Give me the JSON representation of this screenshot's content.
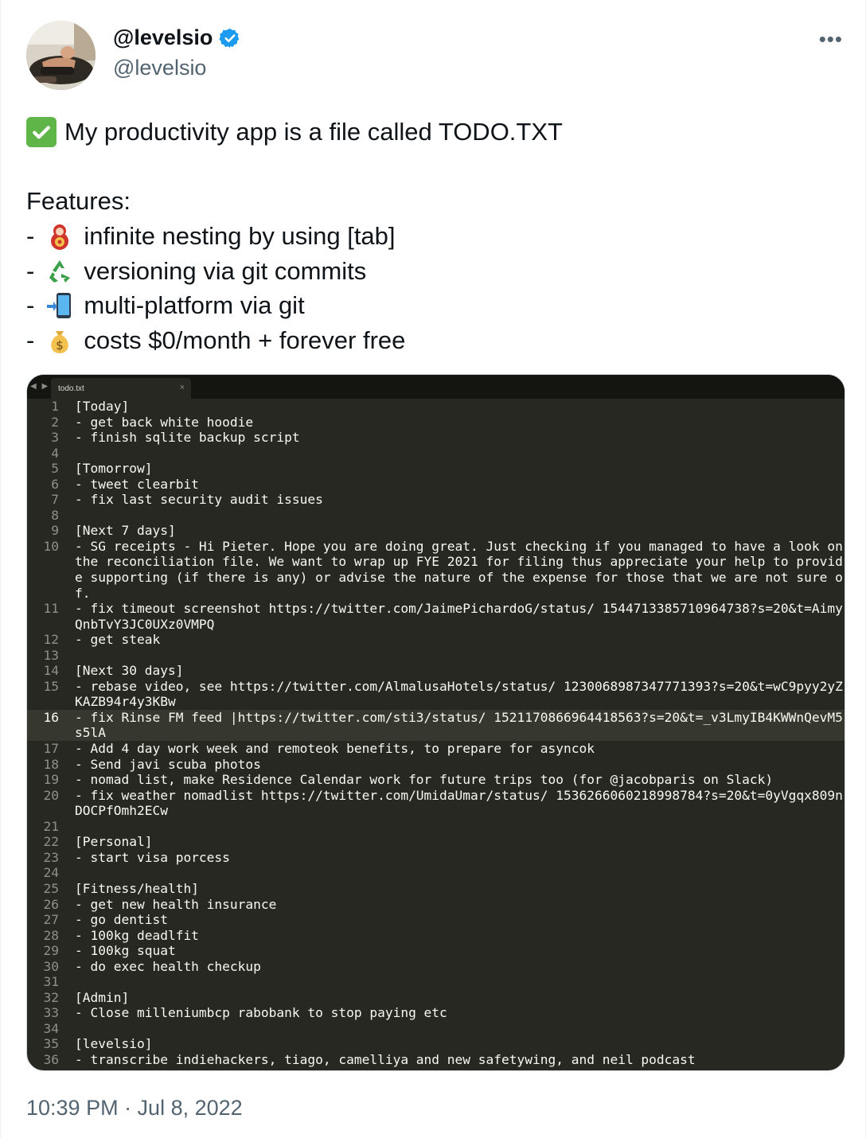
{
  "author": {
    "display_name": "@levelsio",
    "handle": "@levelsio",
    "verified": true,
    "more_label": "•••"
  },
  "tweet": {
    "lines": [
      {
        "prefix": "",
        "emoji": "check-mark-emoji",
        "text": "My productivity app is a file called TODO.TXT"
      },
      {
        "prefix": "",
        "emoji": "",
        "text": ""
      },
      {
        "prefix": "",
        "emoji": "",
        "text": "Features:"
      },
      {
        "prefix": "-",
        "emoji": "nesting-doll-emoji",
        "text": "infinite nesting by using [tab]"
      },
      {
        "prefix": "-",
        "emoji": "recycle-emoji",
        "text": "versioning via git commits"
      },
      {
        "prefix": "-",
        "emoji": "phone-arrow-emoji",
        "text": "multi-platform via git"
      },
      {
        "prefix": "-",
        "emoji": "money-bag-emoji",
        "text": "costs $0/month + forever free"
      }
    ],
    "timestamp": "10:39 PM · Jul 8, 2022"
  },
  "editor": {
    "tab_name": "todo.txt",
    "tab_close": "×",
    "tab_arrows": "◀ ▶",
    "active_line": 16,
    "lines": [
      {
        "n": "1",
        "t": "[Today]"
      },
      {
        "n": "2",
        "t": "- get back white hoodie"
      },
      {
        "n": "3",
        "t": "- finish sqlite backup script"
      },
      {
        "n": "4",
        "t": ""
      },
      {
        "n": "5",
        "t": "[Tomorrow]"
      },
      {
        "n": "6",
        "t": "- tweet clearbit"
      },
      {
        "n": "7",
        "t": "- fix last security audit issues"
      },
      {
        "n": "8",
        "t": ""
      },
      {
        "n": "9",
        "t": "[Next 7 days]"
      },
      {
        "n": "10",
        "t": "- SG receipts - Hi Pieter. Hope you are doing great. Just checking if you managed to have a look on the reconciliation file. We want to wrap up FYE 2021 for filing thus appreciate your help to provide supporting (if there is any) or advise the nature of the expense for those that we are not sure of."
      },
      {
        "n": "11",
        "t": "- fix timeout screenshot https://twitter.com/JaimePichardoG/status/ 1544713385710964738?s=20&t=AimyQnbTvY3JC0UXz0VMPQ"
      },
      {
        "n": "12",
        "t": "- get steak"
      },
      {
        "n": "13",
        "t": ""
      },
      {
        "n": "14",
        "t": "[Next 30 days]"
      },
      {
        "n": "15",
        "t": "- rebase video, see https://twitter.com/AlmalusaHotels/status/ 1230068987347771393?s=20&t=wC9pyy2yZKAZB94r4y3KBw"
      },
      {
        "n": "16",
        "t": "- fix Rinse FM feed |https://twitter.com/sti3/status/ 1521170866964418563?s=20&t=_v3LmyIB4KWWnQevM5s5lA"
      },
      {
        "n": "17",
        "t": "- Add 4 day work week and remoteok benefits, to prepare for asyncok"
      },
      {
        "n": "18",
        "t": "- Send javi scuba photos"
      },
      {
        "n": "19",
        "t": "- nomad list, make Residence Calendar work for future trips too (for @jacobparis on Slack)"
      },
      {
        "n": "20",
        "t": "- fix weather nomadlist https://twitter.com/UmidaUmar/status/ 1536266060218998784?s=20&t=0yVgqx809nDOCPfOmh2ECw"
      },
      {
        "n": "21",
        "t": ""
      },
      {
        "n": "22",
        "t": "[Personal]"
      },
      {
        "n": "23",
        "t": "- start visa porcess"
      },
      {
        "n": "24",
        "t": ""
      },
      {
        "n": "25",
        "t": "[Fitness/health]"
      },
      {
        "n": "26",
        "t": "- get new health insurance"
      },
      {
        "n": "27",
        "t": "- go dentist"
      },
      {
        "n": "28",
        "t": "- 100kg deadlfit"
      },
      {
        "n": "29",
        "t": "- 100kg squat"
      },
      {
        "n": "30",
        "t": "- do exec health checkup"
      },
      {
        "n": "31",
        "t": ""
      },
      {
        "n": "32",
        "t": "[Admin]"
      },
      {
        "n": "33",
        "t": "- Close milleniumbcp rabobank to stop paying etc"
      },
      {
        "n": "34",
        "t": ""
      },
      {
        "n": "35",
        "t": "[levelsio]"
      },
      {
        "n": "36",
        "t": "- transcribe indiehackers, tiago, camelliya and new safetywing, and neil podcast"
      }
    ]
  },
  "colors": {
    "verified_badge": "#1d9bf0",
    "secondary_text": "#536471",
    "editor_bg": "#272822",
    "editor_text": "#f8f8f2"
  }
}
